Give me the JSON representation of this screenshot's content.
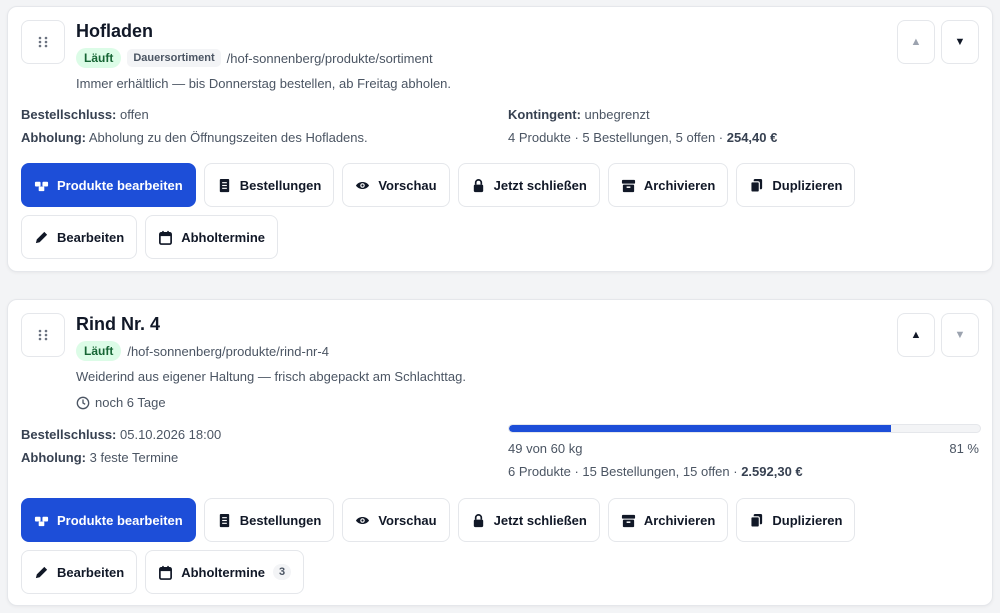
{
  "cards": [
    {
      "title": "Hofladen",
      "status": "Läuft",
      "tag": "Dauersortiment",
      "path": "/hof-sonnenberg/produkte/sortiment",
      "description": "Immer erhältlich — bis Donnerstag bestellen, ab Freitag abholen.",
      "deadline_label": "Bestellschluss:",
      "deadline": "offen",
      "pickup_label": "Abholung:",
      "pickup": "Abholung zu den Öffnungszeiten des Hofladens.",
      "quota_label": "Kontingent:",
      "quota": "unbegrenzt",
      "stats": "4 Produkte · 5 Bestellungen, 5 offen · ",
      "total": "254,40 €",
      "move_up_disabled": true,
      "move_down_disabled": false
    },
    {
      "title": "Rind Nr. 4",
      "status": "Läuft",
      "path": "/hof-sonnenberg/produkte/rind-nr-4",
      "description": "Weiderind aus eigener Haltung — frisch abgepackt am Schlachttag.",
      "countdown": "noch 6 Tage",
      "deadline_label": "Bestellschluss:",
      "deadline": "05.10.2026 18:00",
      "pickup_label": "Abholung:",
      "pickup": "3 feste Termine",
      "progress_text": "49 von 60 kg",
      "progress_percent_label": "81 %",
      "progress_fraction": 0.81,
      "stats": "6 Produkte · 15 Bestellungen, 15 offen · ",
      "total": "2.592,30 €",
      "pickup_count": "3",
      "move_up_disabled": false,
      "move_down_disabled": true
    }
  ],
  "buttons": {
    "edit_products": "Produkte bearbeiten",
    "orders": "Bestellungen",
    "preview": "Vorschau",
    "close_now": "Jetzt schließen",
    "archive": "Archivieren",
    "duplicate": "Duplizieren",
    "edit": "Bearbeiten",
    "pickup_dates": "Abholtermine"
  },
  "icons": {
    "arrow_up": "▲",
    "arrow_down": "▼"
  },
  "colors": {
    "primary": "#1d4ed8",
    "status_bg": "#dcfce7",
    "status_text": "#166534"
  }
}
